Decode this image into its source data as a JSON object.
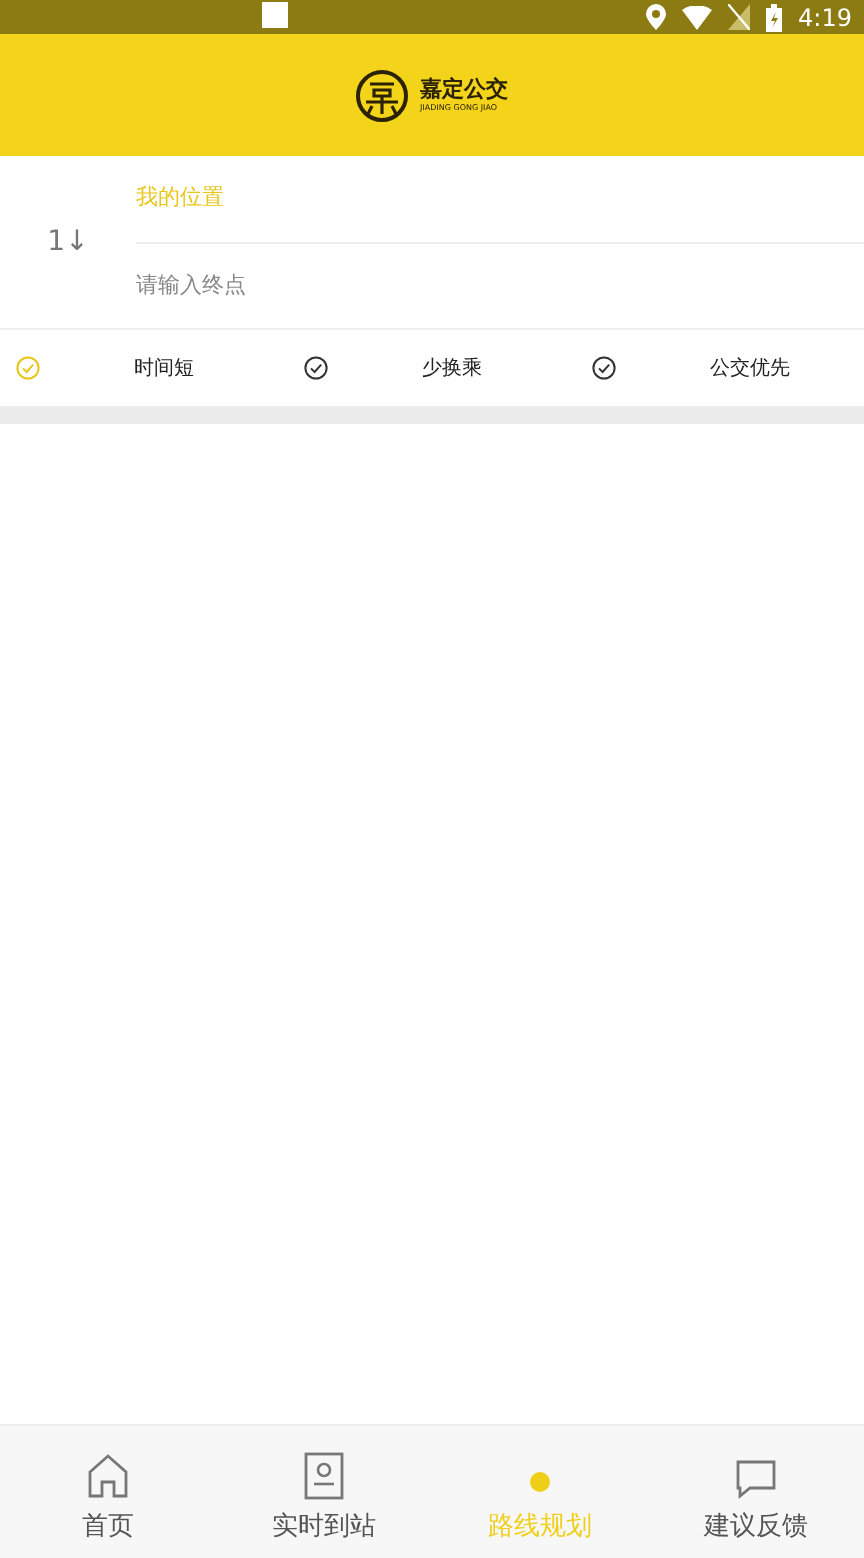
{
  "status_bar": {
    "time": "4:19"
  },
  "header": {
    "logo_title": "嘉定公交",
    "logo_subtitle": "JIADING GONG JIAO"
  },
  "route": {
    "start": "我的位置",
    "destination_placeholder": "请输入终点",
    "swap_icon": "1↓"
  },
  "options": [
    {
      "label": "时间短",
      "selected": true
    },
    {
      "label": "少换乘",
      "selected": false
    },
    {
      "label": "公交优先",
      "selected": false
    }
  ],
  "tabs": [
    {
      "label": "首页",
      "selected": false,
      "kind": "home"
    },
    {
      "label": "实时到站",
      "selected": false,
      "kind": "station"
    },
    {
      "label": "路线规划",
      "selected": true,
      "kind": "route"
    },
    {
      "label": "建议反馈",
      "selected": false,
      "kind": "feedback"
    }
  ]
}
